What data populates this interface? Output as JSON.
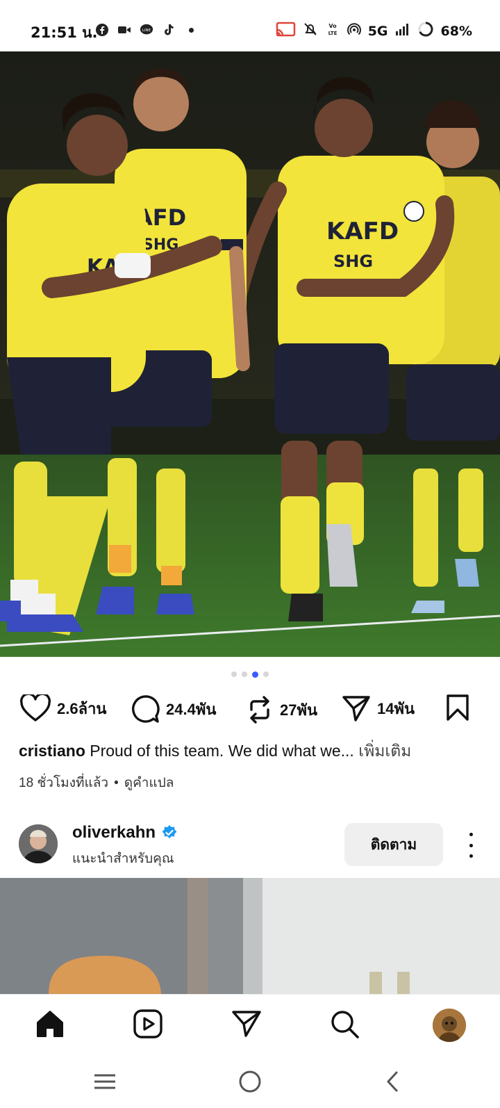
{
  "status_bar": {
    "time": "21:51 น.",
    "network": "5G",
    "battery": "68%",
    "left_icons": [
      "facebook-icon",
      "video-icon",
      "line-icon",
      "tiktok-icon",
      "dot-icon"
    ],
    "right_icons": [
      "cast-icon",
      "mute-icon",
      "volte-icon",
      "hotspot-icon",
      "signal-icon",
      "battery-icon"
    ]
  },
  "post": {
    "carousel": {
      "count": 4,
      "active_index": 2
    },
    "actions": {
      "likes": "2.6ล้าน",
      "comments": "24.4พัน",
      "reposts": "27พัน",
      "shares": "14พัน"
    },
    "caption": {
      "username": "cristiano",
      "text": "Proud of this team. We did what we...",
      "more_label": "เพิ่มเติม"
    },
    "time_ago": "18 ชั่วโมงที่แล้ว",
    "separator": "•",
    "translate_label": "ดูคำแปล"
  },
  "suggestion": {
    "username": "oliverkahn",
    "verified": true,
    "subtitle": "แนะนำสำหรับคุณ",
    "follow_label": "ติดตาม"
  },
  "bottom_nav": [
    "home-icon",
    "reels-icon",
    "direct-icon",
    "search-icon",
    "profile-avatar"
  ],
  "system_nav": [
    "recents-icon",
    "home-circle-icon",
    "back-icon"
  ],
  "colors": {
    "accent": "#3b5bff",
    "verified": "#1d9bf0",
    "jersey": "#f2e43a",
    "shorts": "#1f2236",
    "pitch": "#3b6b2a"
  }
}
